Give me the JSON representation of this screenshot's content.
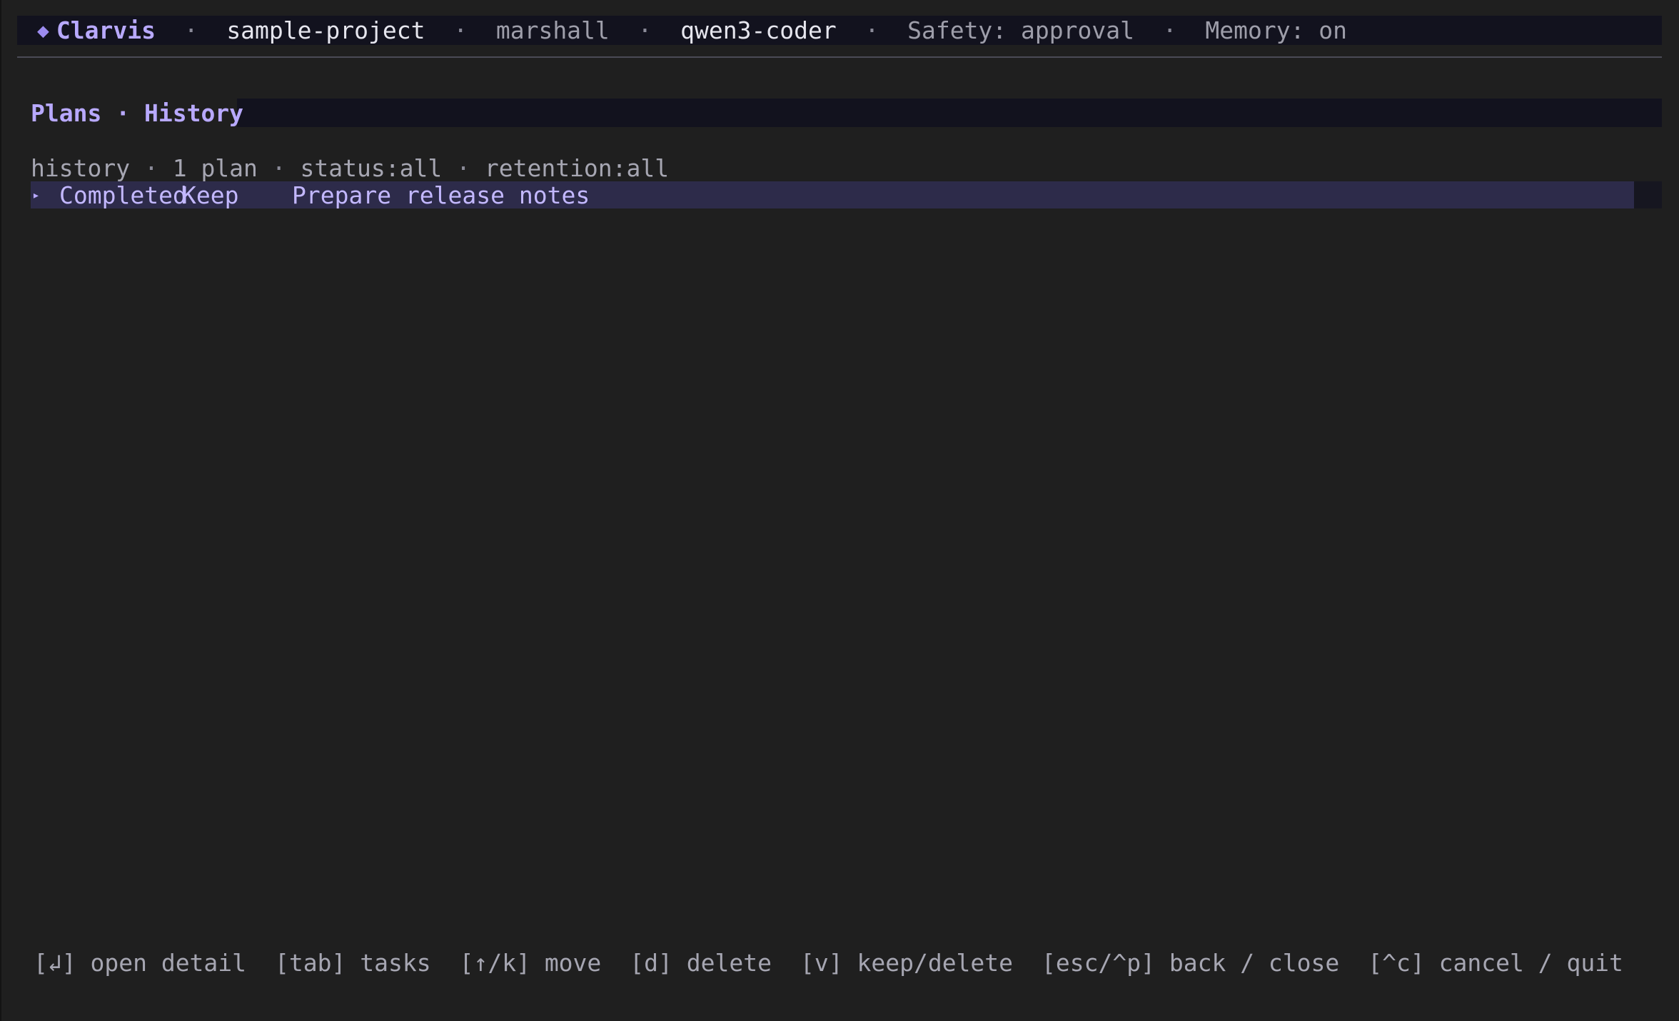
{
  "header": {
    "app_name": "Clarvis",
    "separator": "·",
    "project": "sample-project",
    "user": "marshall",
    "model": "qwen3-coder",
    "safety": "Safety: approval",
    "memory": "Memory: on"
  },
  "title": {
    "section": "Plans",
    "separator": "·",
    "page": "History"
  },
  "summary": {
    "label": "history",
    "count": "1 plan",
    "status_filter": "status:all",
    "retention_filter": "retention:all",
    "separator": "·"
  },
  "rows": [
    {
      "caret": "▸",
      "status": "Completed",
      "retention": "Keep",
      "name": "Prepare release notes",
      "selected": true
    }
  ],
  "footer": {
    "hints": [
      {
        "key": "[↲]",
        "action": "open detail"
      },
      {
        "key": "[tab]",
        "action": "tasks"
      },
      {
        "key": "[↑/k]",
        "action": "move"
      },
      {
        "key": "[d]",
        "action": "delete"
      },
      {
        "key": "[v]",
        "action": "keep/delete"
      },
      {
        "key": "[esc/^p]",
        "action": "back / close"
      },
      {
        "key": "[^c]",
        "action": "cancel / quit"
      }
    ]
  },
  "colors": {
    "background": "#1f1f1f",
    "bar": "#12121e",
    "accent": "#b8a9ff",
    "selection": "#2d2b4a"
  },
  "icons": {
    "brand": "diamond-icon",
    "row_marker": "caret-right-icon"
  }
}
